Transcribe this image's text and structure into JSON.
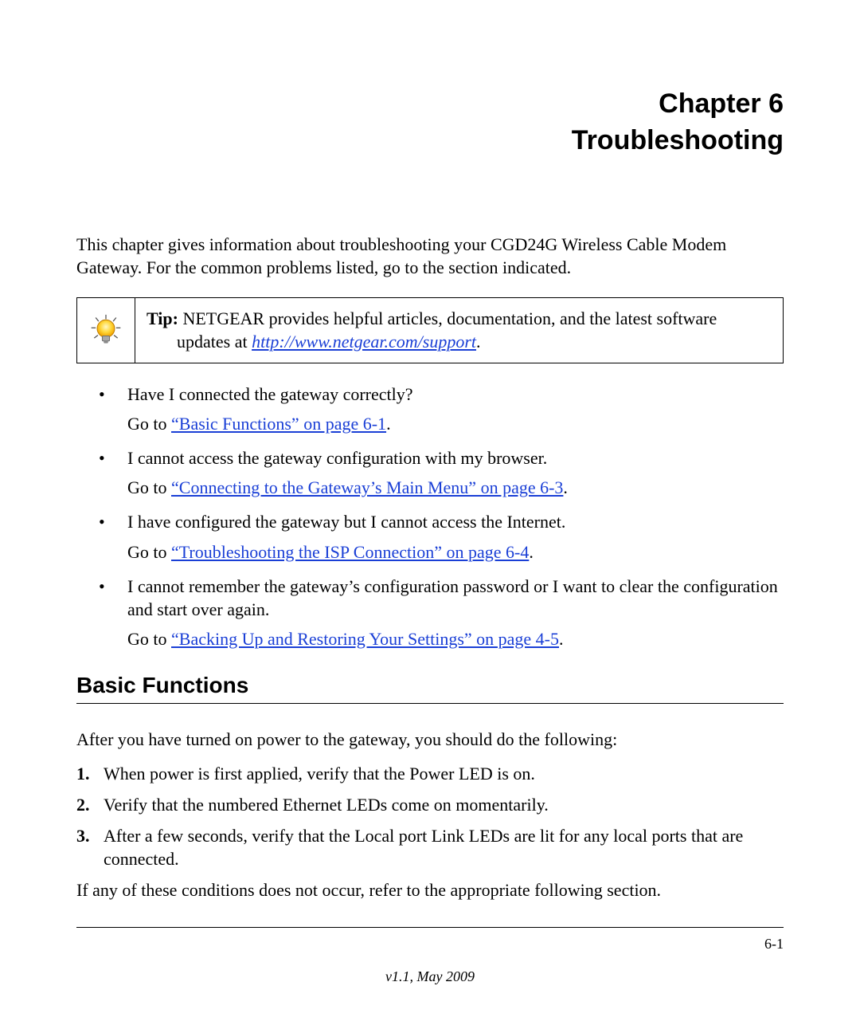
{
  "chapter": {
    "line1": "Chapter 6",
    "line2": "Troubleshooting"
  },
  "intro": "This chapter gives information about troubleshooting your CGD24G Wireless Cable Modem Gateway. For the common problems listed, go to the section indicated.",
  "tip": {
    "label": "Tip:",
    "text_before_link": " NETGEAR provides helpful articles, documentation, and the latest software",
    "text_indent_before_link": "updates at ",
    "link": "http://www.netgear.com/support",
    "text_after_link": "."
  },
  "questions": [
    {
      "q": "Have I connected the gateway correctly?",
      "goto_prefix": "Go to ",
      "goto_link": "“Basic Functions” on page 6-1",
      "goto_suffix": "."
    },
    {
      "q": "I cannot access the gateway configuration with my browser.",
      "goto_prefix": "Go to ",
      "goto_link": "“Connecting to the Gateway’s Main Menu” on page 6-3",
      "goto_suffix": "."
    },
    {
      "q": "I have configured the gateway but I cannot access the Internet.",
      "goto_prefix": "Go to ",
      "goto_link": "“Troubleshooting the ISP Connection” on page 6-4",
      "goto_suffix": "."
    },
    {
      "q": "I cannot remember the gateway’s configuration password or I want to clear the configuration and start over again.",
      "goto_prefix": "Go to ",
      "goto_link": "“Backing Up and Restoring Your Settings” on page 4-5",
      "goto_suffix": "."
    }
  ],
  "section_heading": "Basic Functions",
  "section_intro": "After you have turned on power to the gateway, you should do the following:",
  "steps": [
    "When power is first applied, verify that the Power LED is on.",
    "Verify that the numbered Ethernet LEDs come on momentarily.",
    "After a few seconds, verify that the Local port Link LEDs are lit for any local ports that are connected."
  ],
  "section_outro": "If any of these conditions does not occur, refer to the appropriate following section.",
  "footer": {
    "page": "6-1",
    "version": "v1.1, May 2009"
  }
}
